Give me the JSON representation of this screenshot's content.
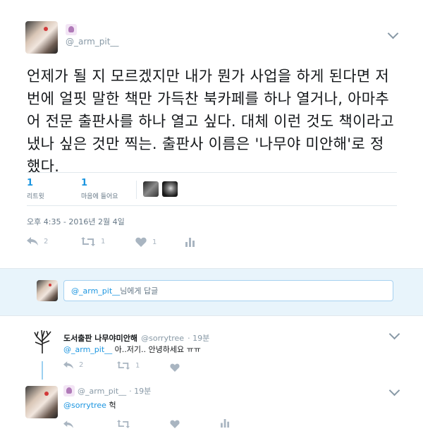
{
  "main_tweet": {
    "handle": "@_arm_pit__",
    "text": "언제가 될 지 모르겠지만 내가 뭔가 사업을 하게 된다면 저번에 얼핏 말한 책만 가득찬 북카페를 하나 열거나, 아마추어 전문 출판사를 하나 열고 싶다. 대체 이런 것도 책이라고 냈나 싶은 것만 찍는. 출판사 이름은 '나무야 미안해'로 정했다.",
    "retweets_count": "1",
    "retweets_label": "리트윗",
    "likes_count": "1",
    "likes_label": "마음에 들어요",
    "timestamp": "오후 4:35 - 2016년 2월 4일",
    "reply_count": "2",
    "retweet_action_count": "1",
    "like_action_count": "1"
  },
  "reply_compose": {
    "mention": "@_arm_pit__",
    "placeholder": " 님에게 답글"
  },
  "reply1": {
    "name": "도서출판 나무야미안해",
    "handle": "@sorrytree",
    "time": "· 19분",
    "mention": "@_arm_pit__",
    "text": " 아..저기.. 안녕하세요 ㅠㅠ",
    "reply_count": "2",
    "retweet_count": "1"
  },
  "reply2": {
    "handle": "@_arm_pit__",
    "time": "· 19분",
    "mention": "@sorrytree",
    "text": " 헉"
  },
  "colors": {
    "accent": "#1b95e0",
    "muted": "#657786",
    "reply_band": "#e8f4fb"
  }
}
